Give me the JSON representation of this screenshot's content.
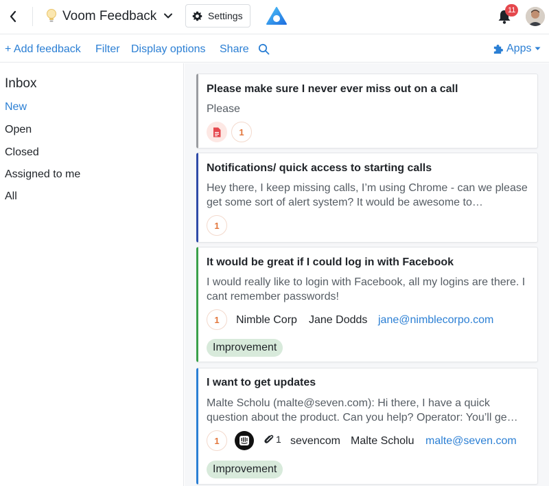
{
  "header": {
    "app_title": "Voom Feedback",
    "settings_label": "Settings",
    "notification_count": "11",
    "icons": [
      "back-chevron-icon",
      "lightbulb-icon",
      "chevron-down-icon",
      "gear-icon",
      "app-logo-icon",
      "bell-icon",
      "avatar"
    ]
  },
  "actions": {
    "add_feedback": "+ Add feedback",
    "filter": "Filter",
    "display_options": "Display options",
    "share": "Share",
    "apps": "Apps"
  },
  "sidebar": {
    "title": "Inbox",
    "items": [
      {
        "label": "New",
        "active": true
      },
      {
        "label": "Open",
        "active": false
      },
      {
        "label": "Closed",
        "active": false
      },
      {
        "label": "Assigned to me",
        "active": false
      },
      {
        "label": "All",
        "active": false
      }
    ]
  },
  "cards": [
    {
      "title": "Please make sure I never ever miss out on a call",
      "body": "Please",
      "count": "1",
      "accent": "#9a9ca0"
    },
    {
      "title": "Notifications/ quick access to starting calls",
      "body": "Hey there, I keep missing calls, I’m using Chrome - can we please get some sort of alert system? It would be awesome to…",
      "count": "1",
      "accent": "#2f4aa8"
    },
    {
      "title": "It would be great if I could log in with Facebook",
      "body": "I would really like to login with Facebook, all my logins are there. I cant remember passwords!",
      "count": "1",
      "company": "Nimble Corp",
      "person": "Jane Dodds",
      "email": "jane@nimblecorpo.com",
      "tag": "Improvement",
      "accent": "#3aa04a"
    },
    {
      "title": "I want to get updates",
      "body": "Malte Scholu (malte@seven.com): Hi there, I have a quick question about the product. Can you help? Operator: You’ll ge…",
      "count": "1",
      "attachments": "1",
      "company": "sevencom",
      "person": "Malte Scholu",
      "email": "malte@seven.com",
      "tag": "Improvement",
      "accent": "#2b7fd4"
    }
  ],
  "colors": {
    "link_blue": "#2b7fd4",
    "badge_red": "#e5484d",
    "count_orange": "#e2773d",
    "tag_green": "#d8eadb"
  }
}
